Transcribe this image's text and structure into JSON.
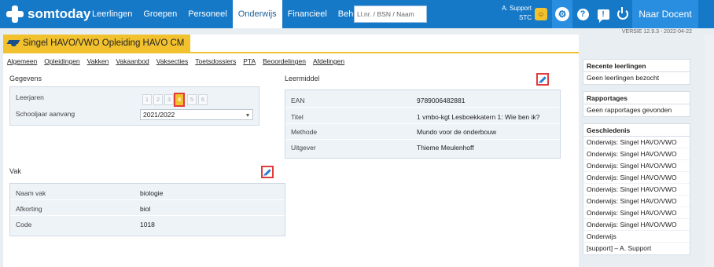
{
  "header": {
    "logo_text": "somtoday",
    "nav": [
      "Leerlingen",
      "Groepen",
      "Personeel",
      "Onderwijs",
      "Financieel",
      "Beheer"
    ],
    "active_nav": "Onderwijs",
    "search_placeholder": "Ll.nr. / BSN / Naam",
    "user_name": "A. Support",
    "user_org": "STC",
    "naar_docent": "Naar Docent"
  },
  "version": "VERSIE 12.9.3 - 2022-04-22",
  "page_title": "Singel HAVO/VWO Opleiding HAVO CM",
  "subnav": [
    "Algemeen",
    "Opleidingen",
    "Vakken",
    "Vakaanbod",
    "Vaksecties",
    "Toetsdossiers",
    "PTA",
    "Beoordelingen",
    "Afdelingen"
  ],
  "gegevens": {
    "title": "Gegevens",
    "leerjaren_label": "Leerjaren",
    "years": [
      "1",
      "2",
      "3",
      "4",
      "5",
      "6"
    ],
    "active_year": "4",
    "schooljaar_label": "Schooljaar aanvang",
    "schooljaar_value": "2021/2022"
  },
  "leermiddel": {
    "title": "Leermiddel",
    "rows": [
      {
        "label": "EAN",
        "value": "9789006482881"
      },
      {
        "label": "Titel",
        "value": "1 vmbo-kgt Lesboekkatern 1: Wie ben ik?"
      },
      {
        "label": "Methode",
        "value": "Mundo voor de onderbouw"
      },
      {
        "label": "Uitgever",
        "value": "Thieme Meulenhoff"
      }
    ]
  },
  "vak": {
    "title": "Vak",
    "rows": [
      {
        "label": "Naam vak",
        "value": "biologie"
      },
      {
        "label": "Afkorting",
        "value": "biol"
      },
      {
        "label": "Code",
        "value": "1018"
      }
    ]
  },
  "sidebar": {
    "recent_title": "Recente leerlingen",
    "recent_empty": "Geen leerlingen bezocht",
    "rapportages_title": "Rapportages",
    "rapportages_empty": "Geen rapportages gevonden",
    "geschiedenis_title": "Geschiedenis",
    "geschiedenis": [
      "Onderwijs: Singel HAVO/VWO",
      "Onderwijs: Singel HAVO/VWO",
      "Onderwijs: Singel HAVO/VWO",
      "Onderwijs: Singel HAVO/VWO",
      "Onderwijs: Singel HAVO/VWO",
      "Onderwijs: Singel HAVO/VWO",
      "Onderwijs: Singel HAVO/VWO",
      "Onderwijs: Singel HAVO/VWO",
      "Onderwijs",
      "[support] – A. Support"
    ]
  }
}
